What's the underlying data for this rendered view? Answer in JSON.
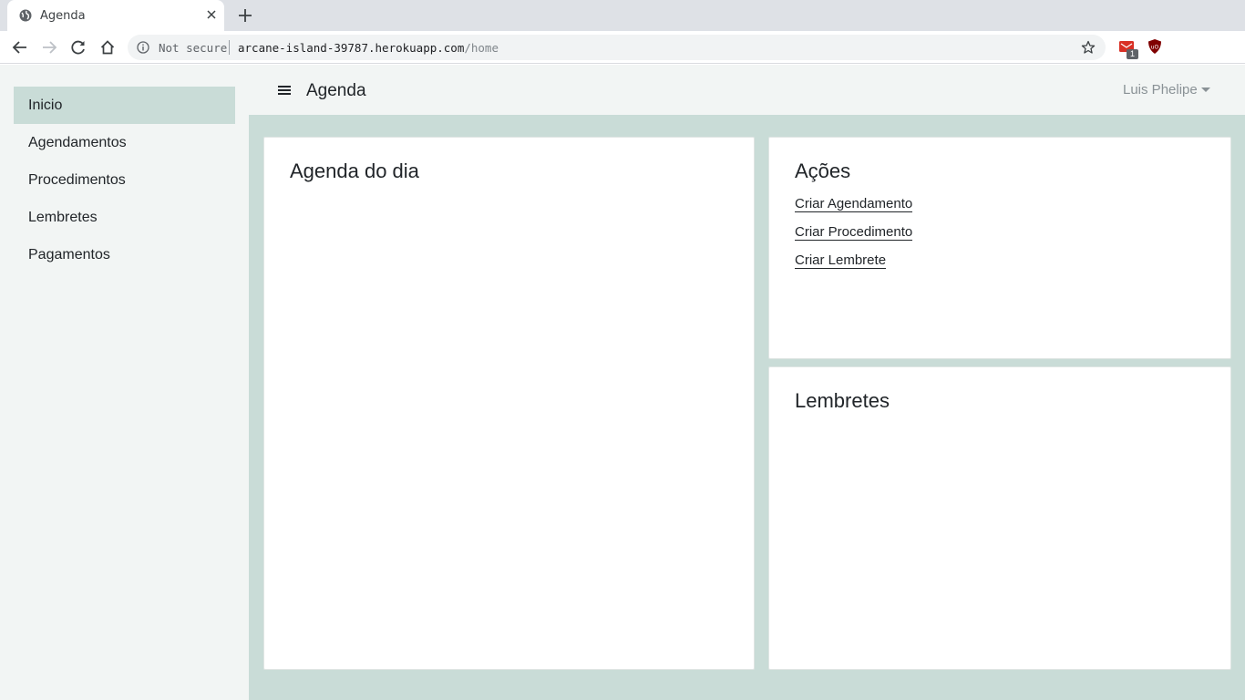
{
  "browser": {
    "tab_title": "Agenda",
    "omnibox": {
      "security_label": "Not secure",
      "host": "arcane-island-39787.herokuapp.com",
      "path": "/home"
    },
    "extension_badge": "1"
  },
  "sidebar": {
    "items": [
      {
        "label": "Inicio",
        "active": true
      },
      {
        "label": "Agendamentos"
      },
      {
        "label": "Procedimentos"
      },
      {
        "label": "Lembretes"
      },
      {
        "label": "Pagamentos"
      }
    ]
  },
  "header": {
    "brand": "Agenda",
    "user_name": "Luis Phelipe"
  },
  "cards": {
    "agenda": {
      "title": "Agenda do dia"
    },
    "acoes": {
      "title": "Ações",
      "links": [
        {
          "label": "Criar Agendamento"
        },
        {
          "label": "Criar Procedimento"
        },
        {
          "label": "Criar Lembrete"
        }
      ]
    },
    "lembretes": {
      "title": "Lembretes"
    }
  },
  "colors": {
    "sidebar_active": "#c9dcd7",
    "content_bg": "#c9dcd7",
    "topbar_bg": "#f2f5f4"
  }
}
